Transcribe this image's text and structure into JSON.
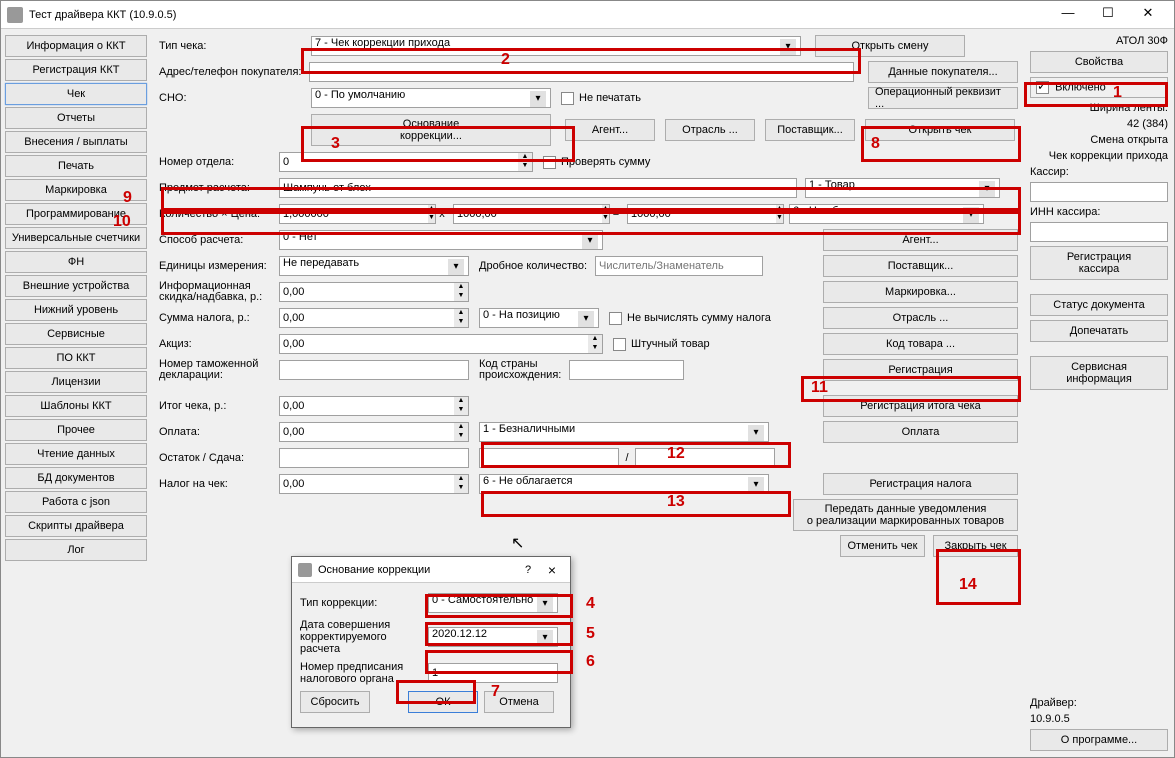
{
  "window": {
    "title": "Тест драйвера ККТ (10.9.0.5)"
  },
  "sidebar": {
    "items": [
      "Информация о ККТ",
      "Регистрация ККТ",
      "Чек",
      "Отчеты",
      "Внесения / выплаты",
      "Печать",
      "Маркировка",
      "Программирование",
      "Универсальные счетчики",
      "ФН",
      "Внешние устройства",
      "Нижний уровень",
      "Сервисные",
      "ПО ККТ",
      "Лицензии",
      "Шаблоны ККТ",
      "Прочее",
      "Чтение данных",
      "БД документов",
      "Работа с json",
      "Скрипты драйвера",
      "Лог"
    ]
  },
  "labels": {
    "tip_cheka": "Тип чека:",
    "adres": "Адрес/телефон покупателя:",
    "sno": "СНО:",
    "nomer_otdela": "Номер отдела:",
    "predmet": "Предмет расчета:",
    "kolvo_cena": "Количество × Цена:",
    "sposob": "Способ расчета:",
    "ed_izm": "Единицы измерения:",
    "inf_skidka": "Информационная\nскидка/надбавка, р.:",
    "sum_naloga": "Сумма налога, р.:",
    "akciz": "Акциз:",
    "decl": "Номер таможенной\nдекларации:",
    "kod_strany": "Код страны\nпроисхождения:",
    "itog": "Итог чека, р.:",
    "oplata": "Оплата:",
    "ostatok": "Остаток / Сдача:",
    "nalog_chek": "Налог на чек:",
    "drob": "Дробное количество:",
    "drob_ph": "Числитель/Знаменатель",
    "shtuch": "Штучный товар",
    "kassir": "Кассир:",
    "inn_kassir": "ИНН кассира:"
  },
  "values": {
    "tip_cheka": "7 - Чек коррекции прихода",
    "sno": "0 - По умолчанию",
    "ne_pechatat": "Не печатать",
    "nomer_otdela": "0",
    "proveryat": "Проверять сумму",
    "predmet": "Шампунь от блох",
    "predmet_type": "1 - Товар",
    "qty": "1,000000",
    "x": "x",
    "price": "1000,00",
    "eq": "=",
    "sum": "1000,00",
    "tax": "6 - Не облагается",
    "sposob": "0 - Нет",
    "ed_izm": "Не передавать",
    "inf_skidka": "0,00",
    "sum_naloga": "0,00",
    "sum_naloga_opt": "0 - На позицию",
    "nevych": "Не вычислять сумму налога",
    "akciz": "0,00",
    "itog": "0,00",
    "oplata": "0,00",
    "oplata_type": "1 - Безналичными",
    "nalog_chek": "0,00",
    "nalog_chek_type": "6 - Не облагается",
    "slash": "/"
  },
  "buttons": {
    "open_smena": "Открыть смену",
    "dannye_pok": "Данные покупателя...",
    "oper_rekv": "Операционный реквизит ...",
    "osn_korr": "Основание\nкоррекции...",
    "agent": "Агент...",
    "otrasl": "Отрасль ...",
    "postavshik": "Поставщик...",
    "open_chek": "Открыть чек",
    "agent2": "Агент...",
    "postavshik2": "Поставщик...",
    "markirovka": "Маркировка...",
    "otrasl2": "Отрасль ...",
    "kod_tovara": "Код товара ...",
    "registraciya": "Регистрация",
    "reg_itoga": "Регистрация итога чека",
    "oplata_btn": "Оплата",
    "reg_naloga": "Регистрация налога",
    "peredat": "Передать данные уведомления\nо реализации маркированных товаров",
    "otmenit": "Отменить чек",
    "zakryt": "Закрыть чек"
  },
  "right": {
    "device": "АТОЛ 30Ф",
    "svoystva": "Свойства",
    "vklyucheno": "Включено",
    "shirina": "Ширина ленты:",
    "shirina_v": "42 (384)",
    "smena": "Смена открыта",
    "chek_korr": "Чек коррекции прихода",
    "reg_kassira": "Регистрация\nкассира",
    "status_doc": "Статус документа",
    "dopechatat": "Допечатать",
    "service": "Сервисная\nинформация",
    "driver": "Драйвер:",
    "driver_v": "10.9.0.5",
    "about": "О программе..."
  },
  "dialog": {
    "title": "Основание коррекции",
    "tip_label": "Тип коррекции:",
    "tip": "0 - Самостоятельно",
    "date_label": "Дата совершения\nкорректируемого расчета",
    "date": "2020.12.12",
    "nomer_label": "Номер предписания\nналогового органа",
    "nomer": "1",
    "reset": "Сбросить",
    "ok": "ОК",
    "cancel": "Отмена",
    "help": "?",
    "close": "×"
  },
  "highlights": {
    "1": "1",
    "2": "2",
    "3": "3",
    "4": "4",
    "5": "5",
    "6": "6",
    "7": "7",
    "8": "8",
    "9": "9",
    "10": "10",
    "11": "11",
    "12": "12",
    "13": "13",
    "14": "14"
  }
}
